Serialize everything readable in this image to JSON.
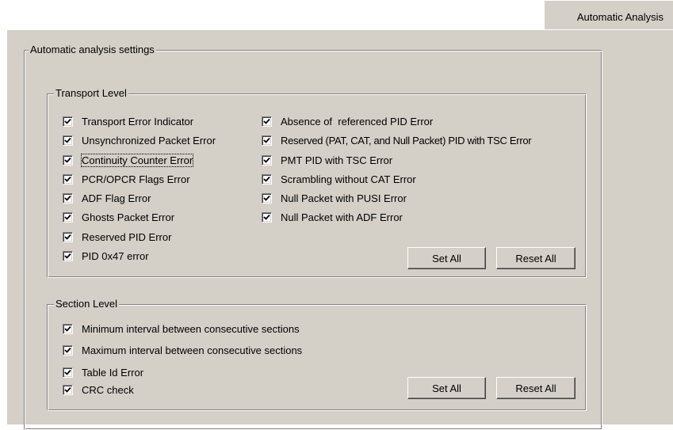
{
  "tab": {
    "label": "Automatic Analysis"
  },
  "settings": {
    "title": "Automatic analysis settings"
  },
  "transport": {
    "title": "Transport Level",
    "left": [
      {
        "label": "Transport Error Indicator",
        "checked": true
      },
      {
        "label": "Unsynchronized Packet Error",
        "checked": true
      },
      {
        "label": "Continuity Counter Error",
        "checked": true
      },
      {
        "label": "PCR/OPCR Flags Error",
        "checked": true
      },
      {
        "label": "ADF Flag Error",
        "checked": true
      },
      {
        "label": "Ghosts Packet Error",
        "checked": true
      },
      {
        "label": "Reserved PID Error",
        "checked": true
      },
      {
        "label": "PID 0x47 error",
        "checked": true
      }
    ],
    "right": [
      {
        "label": "Absence of  referenced PID Error",
        "checked": true
      },
      {
        "label": "Reserved (PAT, CAT, and Null Packet) PID with TSC Error",
        "checked": true
      },
      {
        "label": "PMT PID with TSC Error",
        "checked": true
      },
      {
        "label": "Scrambling without CAT Error",
        "checked": true
      },
      {
        "label": "Null Packet with PUSI Error",
        "checked": true
      },
      {
        "label": "Null Packet with ADF Error",
        "checked": true
      }
    ],
    "set_all": "Set All",
    "reset_all": "Reset All"
  },
  "section": {
    "title": "Section Level",
    "items": [
      {
        "label": "Minimum interval between consecutive sections",
        "checked": true
      },
      {
        "label": "Maximum interval between consecutive sections",
        "checked": true
      },
      {
        "label": "Table Id Error",
        "checked": true
      },
      {
        "label": "CRC check",
        "checked": true
      }
    ],
    "set_all": "Set All",
    "reset_all": "Reset All"
  }
}
